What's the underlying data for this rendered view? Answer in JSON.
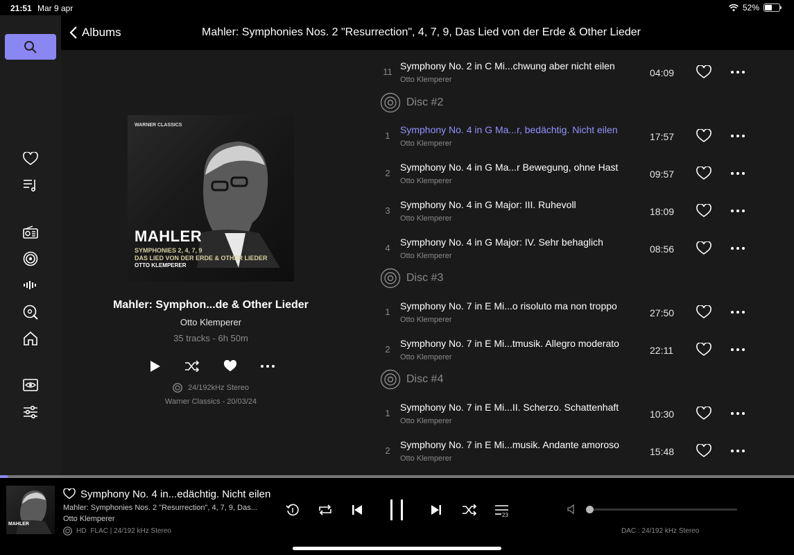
{
  "status": {
    "time": "21:51",
    "date": "Mar 9 apr",
    "battery": "52%",
    "battery_level": 0.52
  },
  "nav": {
    "back_label": "Albums",
    "title": "Mahler: Symphonies Nos. 2 \"Resurrection\", 4, 7, 9, Das Lied von der Erde & Other Lieder"
  },
  "album": {
    "name": "Mahler: Symphon...de & Other Lieder",
    "artist": "Otto Klemperer",
    "stats": "35 tracks - 6h 50m",
    "quality": "24/192kHz Stereo",
    "label": "Warner Classics - 20/03/24",
    "cover": {
      "brand": "WARNER CLASSICS",
      "title": "MAHLER",
      "line1": "SYMPHONIES 2, 4, 7, 9",
      "line2": "DAS LIED VON DER ERDE & OTHER LIEDER",
      "artist": "OTTO KLEMPERER"
    }
  },
  "tracks": {
    "top": {
      "num": "11",
      "title": "Symphony No. 2 in C Mi...chwung aber nicht eilen",
      "artist": "Otto Klemperer",
      "duration": "04:09"
    },
    "disc2": {
      "label": "Disc #2",
      "items": [
        {
          "num": "1",
          "title": "Symphony No. 4 in G Ma...r, bedächtig. Nicht eilen",
          "artist": "Otto Klemperer",
          "duration": "17:57"
        },
        {
          "num": "2",
          "title": "Symphony No. 4 in G Ma...r Bewegung, ohne Hast",
          "artist": "Otto Klemperer",
          "duration": "09:57"
        },
        {
          "num": "3",
          "title": "Symphony No. 4 in G Major: III. Ruhevoll",
          "artist": "Otto Klemperer",
          "duration": "18:09"
        },
        {
          "num": "4",
          "title": "Symphony No. 4 in G Major: IV. Sehr behaglich",
          "artist": "Otto Klemperer",
          "duration": "08:56"
        }
      ]
    },
    "disc3": {
      "label": "Disc #3",
      "items": [
        {
          "num": "1",
          "title": "Symphony No. 7 in E Mi...o risoluto ma non troppo",
          "artist": "Otto Klemperer",
          "duration": "27:50"
        },
        {
          "num": "2",
          "title": "Symphony No. 7 in E Mi...tmusik. Allegro moderato",
          "artist": "Otto Klemperer",
          "duration": "22:11"
        }
      ]
    },
    "disc4": {
      "label": "Disc #4",
      "items": [
        {
          "num": "1",
          "title": "Symphony No. 7 in E Mi...II. Scherzo. Schattenhaft",
          "artist": "Otto Klemperer",
          "duration": "10:30"
        },
        {
          "num": "2",
          "title": "Symphony No. 7 in E Mi...musik. Andante amoroso",
          "artist": "Otto Klemperer",
          "duration": "15:48"
        }
      ]
    }
  },
  "player": {
    "title": "Symphony No. 4 in...edächtig. Nicht eilen",
    "album": "Mahler: Symphonies Nos. 2 \"Resurrection\", 4, 7, 9, Das...",
    "artist": "Otto Klemperer",
    "hd": "HD",
    "format": "FLAC | 24/192 kHz Stereo",
    "queue_count": "23",
    "dac": "DAC : 24/192 kHz Stereo",
    "thumb_title": "MAHLER",
    "progress": 0.01,
    "volume": 0.0
  },
  "colors": {
    "accent": "#8a87f3",
    "active_track": "#9591ff"
  }
}
